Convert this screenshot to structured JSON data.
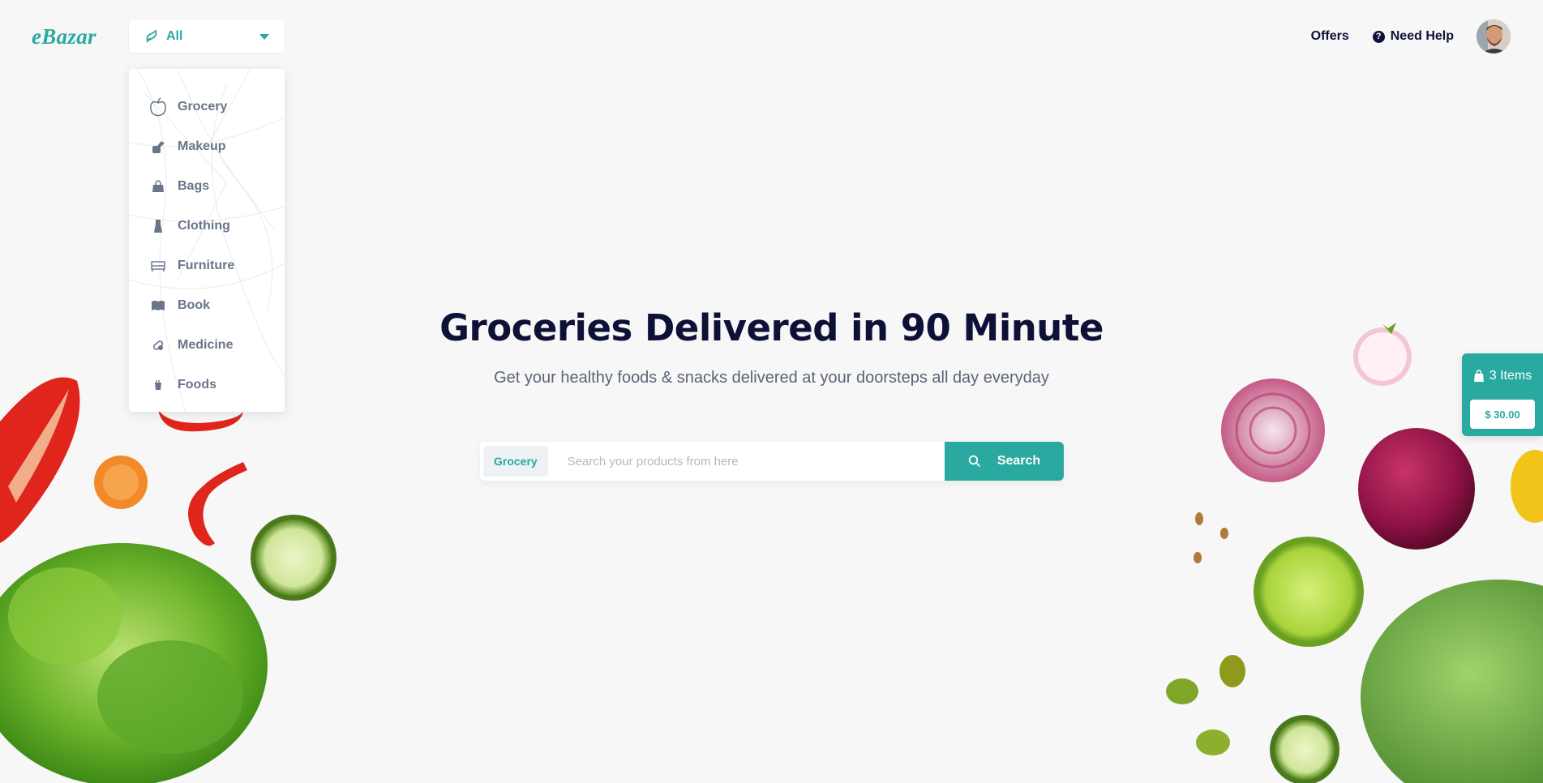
{
  "header": {
    "logo": "eBazar",
    "category_selector": {
      "selected": "All",
      "icon": "grocery-icon"
    },
    "nav": [
      {
        "label": "Offers"
      },
      {
        "label": "Need Help",
        "icon": "help-icon"
      }
    ],
    "avatar": "user-avatar"
  },
  "dropdown": {
    "items": [
      {
        "label": "Grocery",
        "icon": "apple-icon"
      },
      {
        "label": "Makeup",
        "icon": "makeup-icon"
      },
      {
        "label": "Bags",
        "icon": "bag-icon"
      },
      {
        "label": "Clothing",
        "icon": "dress-icon"
      },
      {
        "label": "Furniture",
        "icon": "bed-icon"
      },
      {
        "label": "Book",
        "icon": "book-icon"
      },
      {
        "label": "Medicine",
        "icon": "pill-icon"
      },
      {
        "label": "Foods",
        "icon": "food-icon"
      }
    ]
  },
  "hero": {
    "title": "Groceries Delivered in 90 Minute",
    "subtitle": "Get your healthy foods & snacks delivered at your doorsteps all day everyday"
  },
  "search": {
    "tag": "Grocery",
    "placeholder": "Search your products from here",
    "value": "",
    "button_label": "Search"
  },
  "cart": {
    "items_label": "3 Items",
    "price": "$ 30.00"
  },
  "colors": {
    "accent": "#2aa9a0",
    "text_dark": "#0d1136",
    "text_muted": "#6a7589",
    "background": "#f7f7f7"
  }
}
